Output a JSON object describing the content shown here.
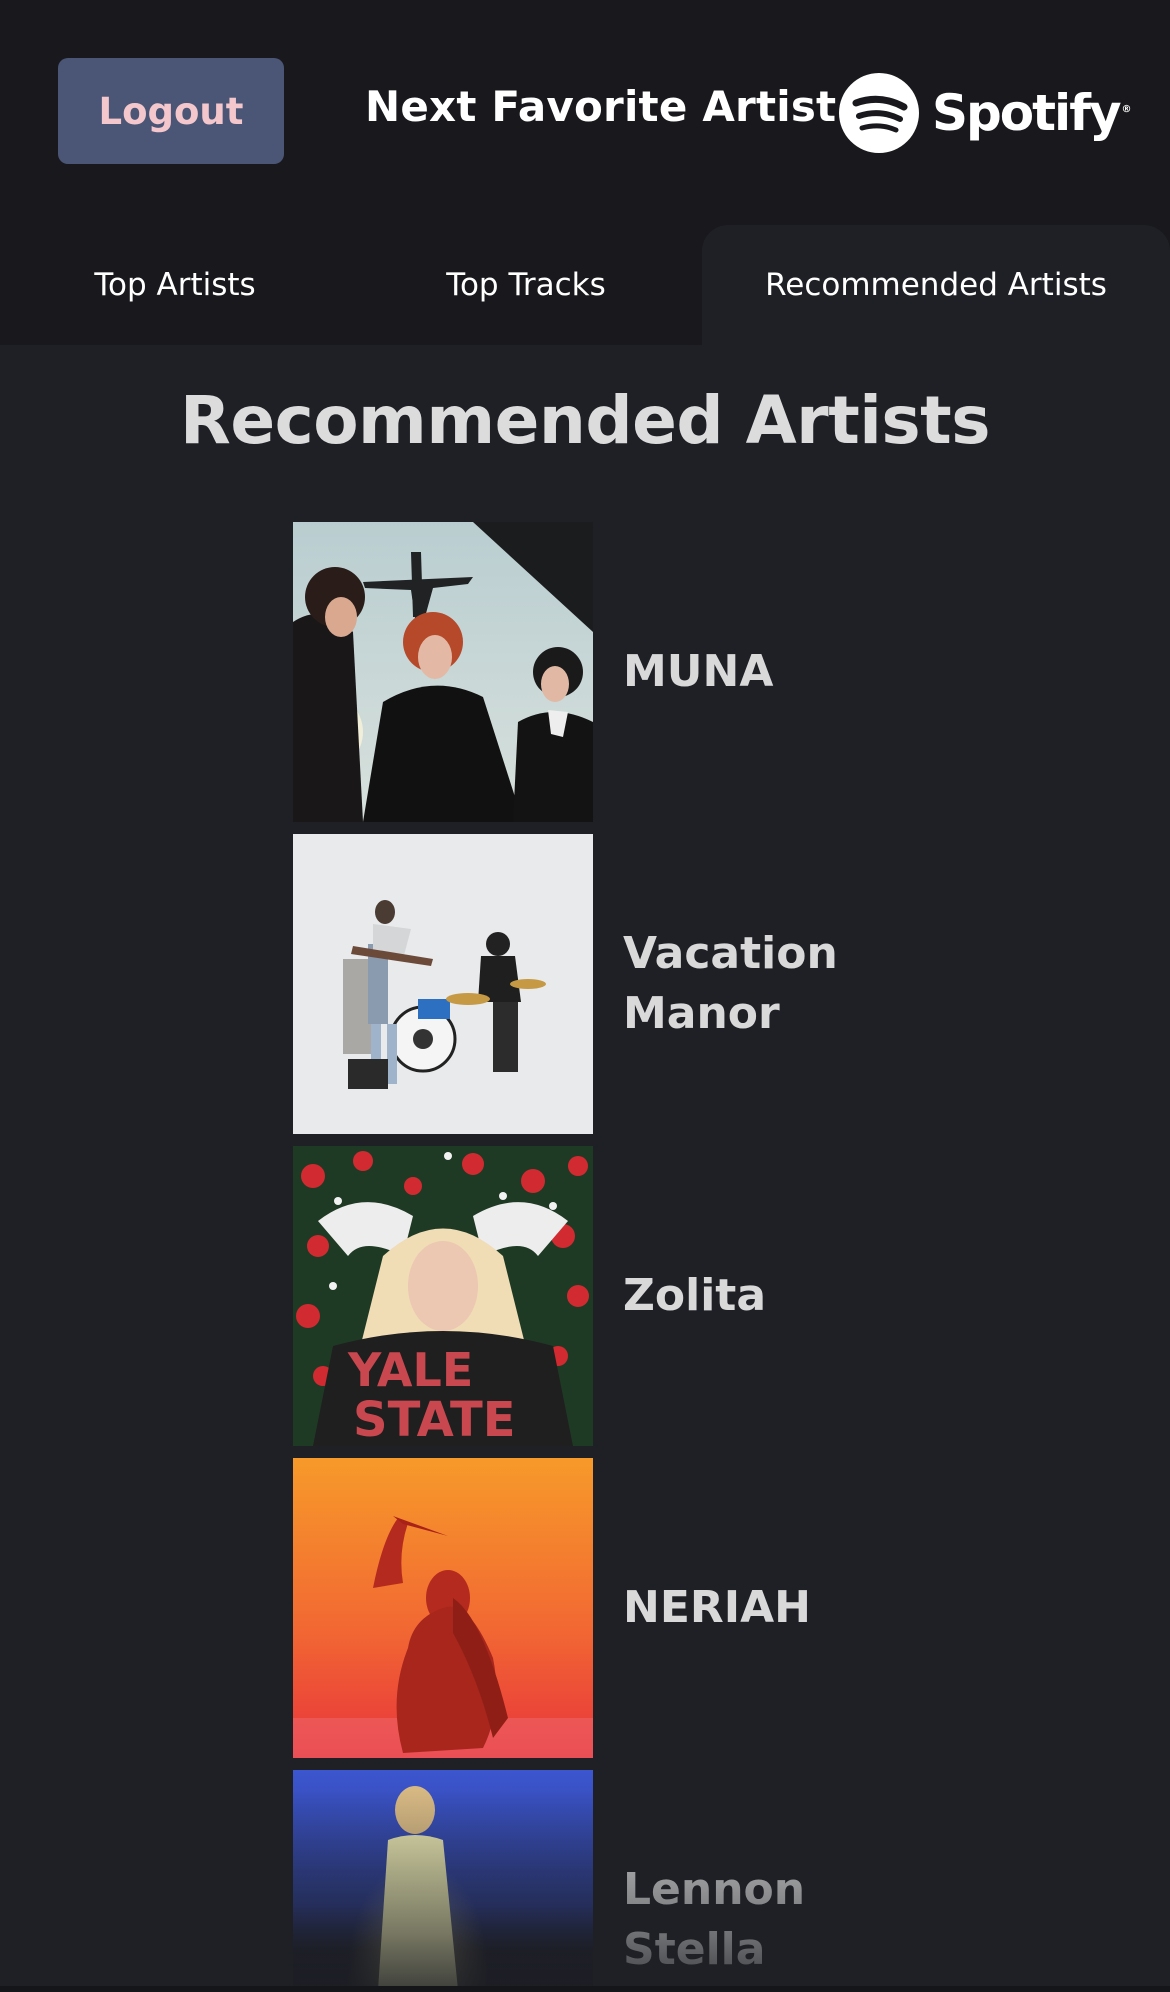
{
  "header": {
    "logout_label": "Logout",
    "app_title": "Next Favorite Artist",
    "brand": "Spotify",
    "brand_mark": "®"
  },
  "tabs": [
    {
      "label": "Top Artists",
      "active": false
    },
    {
      "label": "Top Tracks",
      "active": false
    },
    {
      "label": "Recommended Artists",
      "active": true
    }
  ],
  "main": {
    "section_title": "Recommended Artists",
    "artists": [
      {
        "name": "MUNA",
        "image": "band-photo-three-members-airplane"
      },
      {
        "name": "Vacation Manor",
        "image": "band-photo-guitar-drums-white-backdrop"
      },
      {
        "name": "Zolita",
        "image": "portrait-red-roses-blonde"
      },
      {
        "name": "NERIAH",
        "image": "silhouette-orange-sunset"
      },
      {
        "name": "Lennon Stella",
        "image": "figure-blue-dusk-glow"
      }
    ]
  },
  "colors": {
    "background": "#1e2025",
    "header": "#18181d",
    "logout_button": "#4b5676",
    "logout_text": "#f4c7cc"
  }
}
